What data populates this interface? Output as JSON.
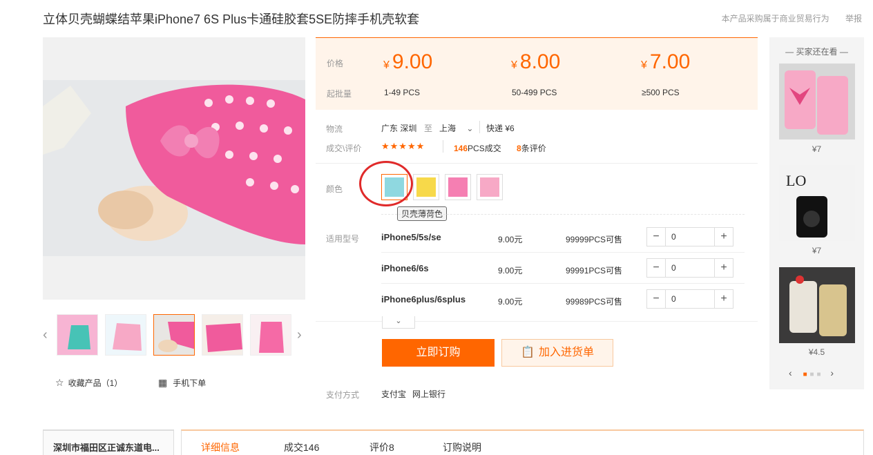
{
  "product": {
    "title": "立体贝壳蝴蝶结苹果iPhone7 6S Plus卡通硅胶套5SE防摔手机壳软套"
  },
  "top_links": {
    "note": "本产品采购属于商业贸易行为",
    "report": "举报"
  },
  "pricing": {
    "price_label": "价格",
    "moq_label": "起批量",
    "currency": "¥",
    "tiers": [
      {
        "price": "9.00",
        "range": "1-49  PCS"
      },
      {
        "price": "8.00",
        "range": "50-499  PCS"
      },
      {
        "price": "7.00",
        "range": "≥500  PCS"
      }
    ]
  },
  "logistics": {
    "label": "物流",
    "from": "广东 深圳",
    "to_word": "至",
    "to": "上海",
    "shipping": "快递 ¥6"
  },
  "deals": {
    "label": "成交\\评价",
    "stars": "★★★★★",
    "volume": "146",
    "volume_suffix": "PCS成交",
    "reviews": "8",
    "reviews_suffix": "条评价"
  },
  "color": {
    "label": "颜色",
    "tooltip": "贝壳薄荷色",
    "swatch_colors": [
      "#8fd8e0",
      "#f7d94a",
      "#f57fb2",
      "#f7a9c6"
    ]
  },
  "models": {
    "label": "适用型号",
    "rows": [
      {
        "name": "iPhone5/5s/se",
        "price": "9.00元",
        "stock": "99999PCS可售",
        "qty": "0"
      },
      {
        "name": "iPhone6/6s",
        "price": "9.00元",
        "stock": "99991PCS可售",
        "qty": "0"
      },
      {
        "name": "iPhone6plus/6splus",
        "price": "9.00元",
        "stock": "99989PCS可售",
        "qty": "0"
      }
    ]
  },
  "actions": {
    "buy": "立即订购",
    "cart": "加入进货单"
  },
  "payment": {
    "label": "支付方式",
    "methods": [
      "支付宝",
      "网上银行"
    ]
  },
  "gallery": {
    "collect": "收藏产品（1）",
    "mobile": "手机下单"
  },
  "sidebar": {
    "title": "买家还在看",
    "items": [
      {
        "price": "¥7"
      },
      {
        "price": "¥7"
      },
      {
        "price": "¥4.5"
      }
    ]
  },
  "bottom": {
    "company": "深圳市福田区正诚东道电...",
    "tabs": [
      "详细信息",
      "成交146",
      "评价8",
      "订购说明"
    ]
  }
}
